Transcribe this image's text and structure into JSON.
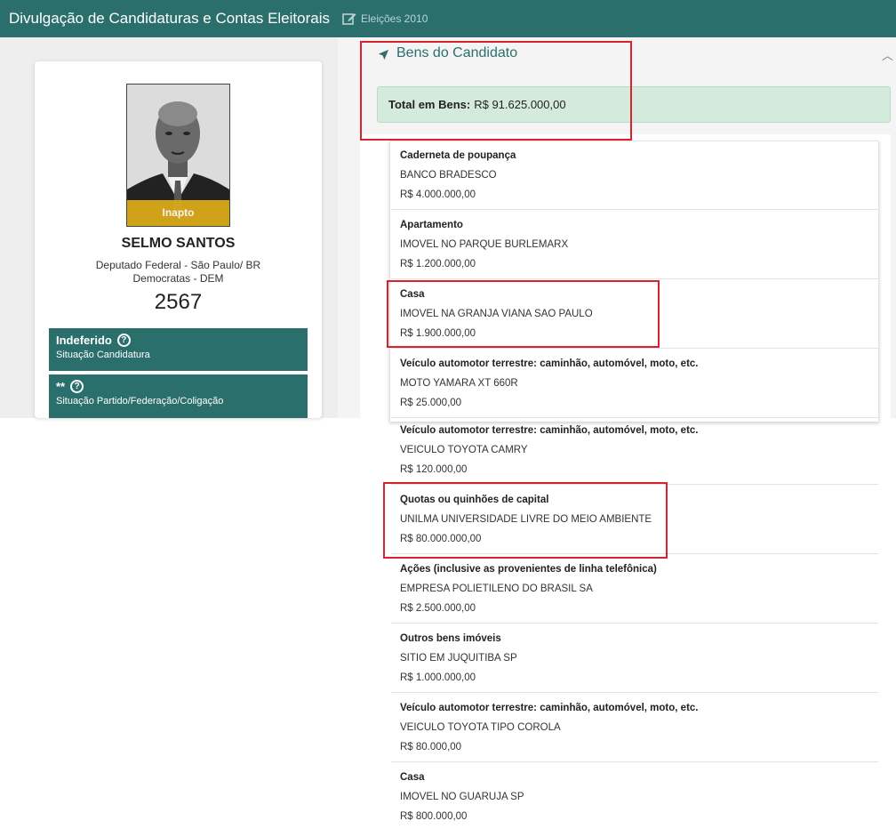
{
  "header": {
    "title": "Divulgação de Candidaturas e Contas Eleitorais",
    "election": "Eleições 2010"
  },
  "candidate": {
    "badge": "Inapto",
    "name": "SELMO SANTOS",
    "role": "Deputado Federal - São Paulo/ BR",
    "party": "Democratas - DEM",
    "number": "2567",
    "status": [
      {
        "main": "Indeferido",
        "sub": "Situação Candidatura"
      },
      {
        "main": "**",
        "sub": "Situação Partido/Federação/Coligação"
      }
    ]
  },
  "assets": {
    "title": "Bens do Candidato",
    "total_label": "Total em Bens:",
    "total_value": "R$ 91.625.000,00",
    "items": [
      {
        "type": "Caderneta de poupança",
        "desc": "BANCO BRADESCO",
        "value": "R$ 4.000.000,00"
      },
      {
        "type": "Apartamento",
        "desc": "IMOVEL NO PARQUE BURLEMARX",
        "value": "R$ 1.200.000,00"
      },
      {
        "type": "Casa",
        "desc": "IMOVEL NA GRANJA VIANA SAO PAULO",
        "value": "R$ 1.900.000,00"
      },
      {
        "type": "Veículo automotor terrestre: caminhão, automóvel, moto, etc.",
        "desc": "MOTO YAMARA XT 660R",
        "value": "R$ 25.000,00"
      },
      {
        "type": "Veículo automotor terrestre: caminhão, automóvel, moto, etc.",
        "desc": "VEICULO TOYOTA CAMRY",
        "value": "R$ 120.000,00"
      },
      {
        "type": "Quotas ou quinhões de capital",
        "desc": "UNILMA UNIVERSIDADE LIVRE DO MEIO AMBIENTE",
        "value": "R$ 80.000.000,00"
      },
      {
        "type": "Ações (inclusive as provenientes de linha telefônica)",
        "desc": "EMPRESA POLIETILENO DO BRASIL SA",
        "value": "R$ 2.500.000,00"
      },
      {
        "type": "Outros bens imóveis",
        "desc": "SITIO EM JUQUITIBA SP",
        "value": "R$ 1.000.000,00"
      },
      {
        "type": "Veículo automotor terrestre: caminhão, automóvel, moto, etc.",
        "desc": "VEICULO TOYOTA TIPO COROLA",
        "value": "R$ 80.000,00"
      },
      {
        "type": "Casa",
        "desc": "IMOVEL NO GUARUJA SP",
        "value": "R$ 800.000,00"
      }
    ]
  },
  "colors": {
    "brand": "#2b6f6d",
    "badge": "#d9a917",
    "highlight": "#d6242e",
    "total_bg": "#d4eadc"
  }
}
